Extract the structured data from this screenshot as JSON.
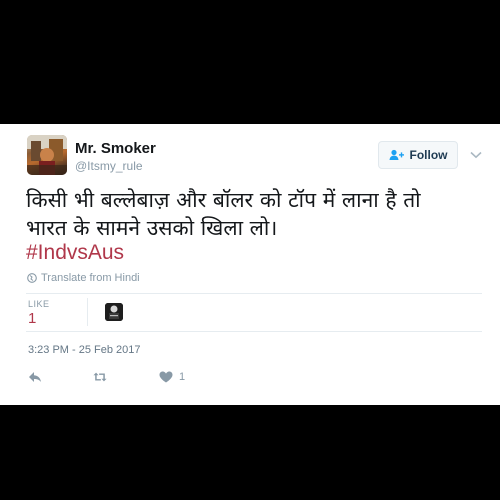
{
  "tweet": {
    "author": {
      "display_name": "Mr. Smoker",
      "handle": "@Itsmy_rule"
    },
    "follow_label": "Follow",
    "text_line1": "किसी भी बल्लेबाज़ और बॉलर को टॉप में लाना है तो",
    "text_line2": "भारत के सामने उसको खिला लो।",
    "hashtag": "#IndvsAus",
    "translate_label": "Translate from Hindi",
    "likes_label": "LIKE",
    "likes_count": "1",
    "timestamp": "3:23 PM - 25 Feb 2017",
    "actions": {
      "like_count": "1"
    }
  },
  "colors": {
    "hashtag": "#b0374a",
    "muted": "#8899a6",
    "text": "#14171a",
    "background_frame": "#000000"
  },
  "icons": [
    "caret-down-icon",
    "follow-person-icon",
    "globe-icon",
    "reply-icon",
    "retweet-icon",
    "heart-icon"
  ]
}
